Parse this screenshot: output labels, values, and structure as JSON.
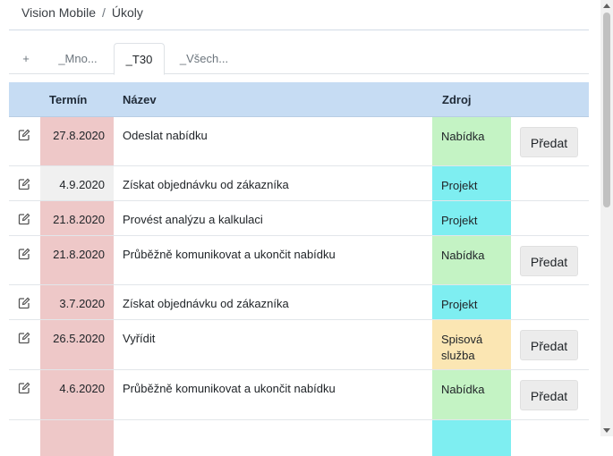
{
  "breadcrumb": {
    "app": "Vision Mobile",
    "separator": "/",
    "page": "Úkoly"
  },
  "tabs": [
    {
      "label": "+"
    },
    {
      "label": "_Mno..."
    },
    {
      "label": "_T30"
    },
    {
      "label": "_Všech..."
    }
  ],
  "table": {
    "headers": {
      "termin": "Termín",
      "nazev": "Název",
      "zdroj": "Zdroj"
    },
    "button_label": "Předat",
    "rows": [
      {
        "date": "27.8.2020",
        "title": "Odeslat nabídku",
        "source": "Nabídka",
        "date_style": "overdue",
        "source_style": "nabidka",
        "has_button": true
      },
      {
        "date": "4.9.2020",
        "title": "Získat objednávku od zákazníka",
        "source": "Projekt",
        "date_style": "normal",
        "source_style": "projekt",
        "has_button": false
      },
      {
        "date": "21.8.2020",
        "title": "Provést analýzu a kalkulaci",
        "source": "Projekt",
        "date_style": "overdue",
        "source_style": "projekt",
        "has_button": false
      },
      {
        "date": "21.8.2020",
        "title": "Průběžně komunikovat a ukončit nabídku",
        "source": "Nabídka",
        "date_style": "overdue",
        "source_style": "nabidka",
        "has_button": true
      },
      {
        "date": "3.7.2020",
        "title": "Získat objednávku od zákazníka",
        "source": "Projekt",
        "date_style": "overdue",
        "source_style": "projekt",
        "has_button": false
      },
      {
        "date": "26.5.2020",
        "title": "Vyřídit",
        "source": "Spisová služba",
        "date_style": "overdue",
        "source_style": "spisova",
        "has_button": true
      },
      {
        "date": "4.6.2020",
        "title": "Průběžně komunikovat a ukončit nabídku",
        "source": "Nabídka",
        "date_style": "overdue",
        "source_style": "nabidka",
        "has_button": true
      }
    ]
  },
  "colors": {
    "header_bg": "#c6dcf3",
    "date_overdue": "#eec8c8",
    "date_normal": "#f0f0f0",
    "source_nabidka": "#c4f3c4",
    "source_projekt": "#7eeef1",
    "source_spisova": "#fbe6b3"
  },
  "icons": {
    "edit": "edit-icon"
  }
}
